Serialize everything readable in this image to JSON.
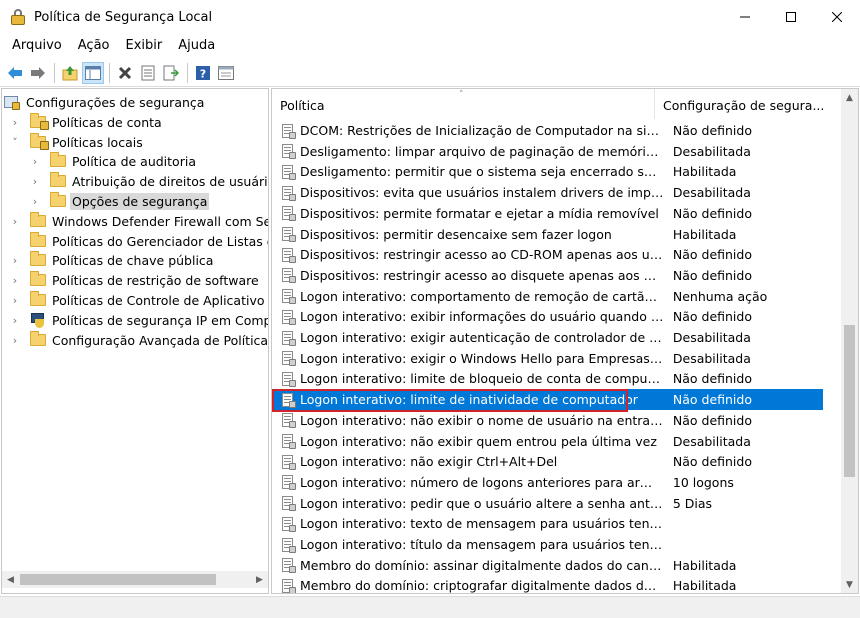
{
  "window": {
    "title": "Política de Segurança Local",
    "minimize_icon": "minimize-icon",
    "maximize_icon": "maximize-icon",
    "close_icon": "close-icon"
  },
  "menu": {
    "items": [
      {
        "label": "Arquivo"
      },
      {
        "label": "Ação"
      },
      {
        "label": "Exibir"
      },
      {
        "label": "Ajuda"
      }
    ]
  },
  "toolbar": {
    "icons": [
      "back-arrow-icon",
      "forward-arrow-icon",
      "up-folder-icon",
      "show-hide-tree-icon",
      "delete-icon",
      "properties-icon",
      "export-list-icon",
      "help-icon",
      "console-tree-icon"
    ]
  },
  "tree": {
    "items": [
      {
        "label": "Configurações de segurança",
        "level": 0,
        "expander": "",
        "icon": "security-settings-icon"
      },
      {
        "label": "Políticas de conta",
        "level": 1,
        "expander": "›",
        "icon": "locked-folder-icon"
      },
      {
        "label": "Políticas locais",
        "level": 1,
        "expander": "˅",
        "icon": "locked-folder-icon"
      },
      {
        "label": "Política de auditoria",
        "level": 2,
        "expander": "›",
        "icon": "folder-icon"
      },
      {
        "label": "Atribuição de direitos de usuário",
        "level": 2,
        "expander": "›",
        "icon": "folder-icon"
      },
      {
        "label": "Opções de segurança",
        "level": 2,
        "expander": "›",
        "icon": "folder-icon",
        "selected": true
      },
      {
        "label": "Windows Defender Firewall com Segu",
        "level": 1,
        "expander": "›",
        "icon": "folder-icon"
      },
      {
        "label": "Políticas do Gerenciador de Listas de I",
        "level": 1,
        "expander": "",
        "icon": "folder-icon"
      },
      {
        "label": "Políticas de chave pública",
        "level": 1,
        "expander": "›",
        "icon": "folder-icon"
      },
      {
        "label": "Políticas de restrição de software",
        "level": 1,
        "expander": "›",
        "icon": "folder-icon"
      },
      {
        "label": "Políticas de Controle de Aplicativo",
        "level": 1,
        "expander": "›",
        "icon": "folder-icon"
      },
      {
        "label": "Políticas de segurança IP em Comput",
        "level": 1,
        "expander": "›",
        "icon": "ip-security-icon"
      },
      {
        "label": "Configuração Avançada de Política de",
        "level": 1,
        "expander": "›",
        "icon": "folder-icon"
      }
    ]
  },
  "list": {
    "columns": [
      "Política",
      "Configuração de segura..."
    ],
    "rows": [
      {
        "policy": "DCOM: Restrições de Inicialização de Computador na sintax...",
        "setting": "Não definido"
      },
      {
        "policy": "Desligamento: limpar arquivo de paginação de memória virt...",
        "setting": "Desabilitada"
      },
      {
        "policy": "Desligamento: permitir que o sistema seja encerrado sem a ...",
        "setting": "Habilitada"
      },
      {
        "policy": "Dispositivos: evita que usuários instalem drivers de impresso...",
        "setting": "Desabilitada"
      },
      {
        "policy": "Dispositivos: permite formatar e ejetar a mídia removível",
        "setting": "Não definido"
      },
      {
        "policy": "Dispositivos: permitir desencaixe sem fazer logon",
        "setting": "Habilitada"
      },
      {
        "policy": "Dispositivos: restringir acesso ao CD-ROM apenas aos usuári...",
        "setting": "Não definido"
      },
      {
        "policy": "Dispositivos: restringir acesso ao disquete apenas aos usuári...",
        "setting": "Não definido"
      },
      {
        "policy": "Logon interativo: comportamento de remoção de cartão int...",
        "setting": "Nenhuma ação"
      },
      {
        "policy": "Logon interativo: exibir informações do usuário quando a se...",
        "setting": "Não definido"
      },
      {
        "policy": "Logon interativo: exigir autenticação de controlador de dom...",
        "setting": "Desabilitada"
      },
      {
        "policy": "Logon interativo: exigir o Windows Hello para Empresas ou ...",
        "setting": "Desabilitada"
      },
      {
        "policy": "Logon interativo: limite de bloqueio de conta de computador",
        "setting": "Não definido"
      },
      {
        "policy": "Logon interativo: limite de inatividade de computador",
        "setting": "Não definido",
        "selected": true
      },
      {
        "policy": "Logon interativo: não exibir o nome de usuário na entrada",
        "setting": "Não definido"
      },
      {
        "policy": "Logon interativo: não exibir quem entrou pela última vez",
        "setting": "Desabilitada"
      },
      {
        "policy": "Logon interativo: não exigir Ctrl+Alt+Del",
        "setting": "Não definido"
      },
      {
        "policy": "Logon interativo: número de logons anteriores para armaze...",
        "setting": "10 logons"
      },
      {
        "policy": "Logon interativo: pedir que o usuário altere a senha antes q...",
        "setting": "5 Dias"
      },
      {
        "policy": "Logon interativo: texto de mensagem para usuários tentand...",
        "setting": ""
      },
      {
        "policy": "Logon interativo: título da mensagem para usuários tentand...",
        "setting": ""
      },
      {
        "policy": "Membro do domínio: assinar digitalmente dados do canal s...",
        "setting": "Habilitada"
      },
      {
        "policy": "Membro do domínio: criptografar digitalmente dados do ca...",
        "setting": "Habilitada"
      }
    ]
  },
  "colors": {
    "selection": "#0078d7",
    "highlight_border": "#d3232a"
  }
}
